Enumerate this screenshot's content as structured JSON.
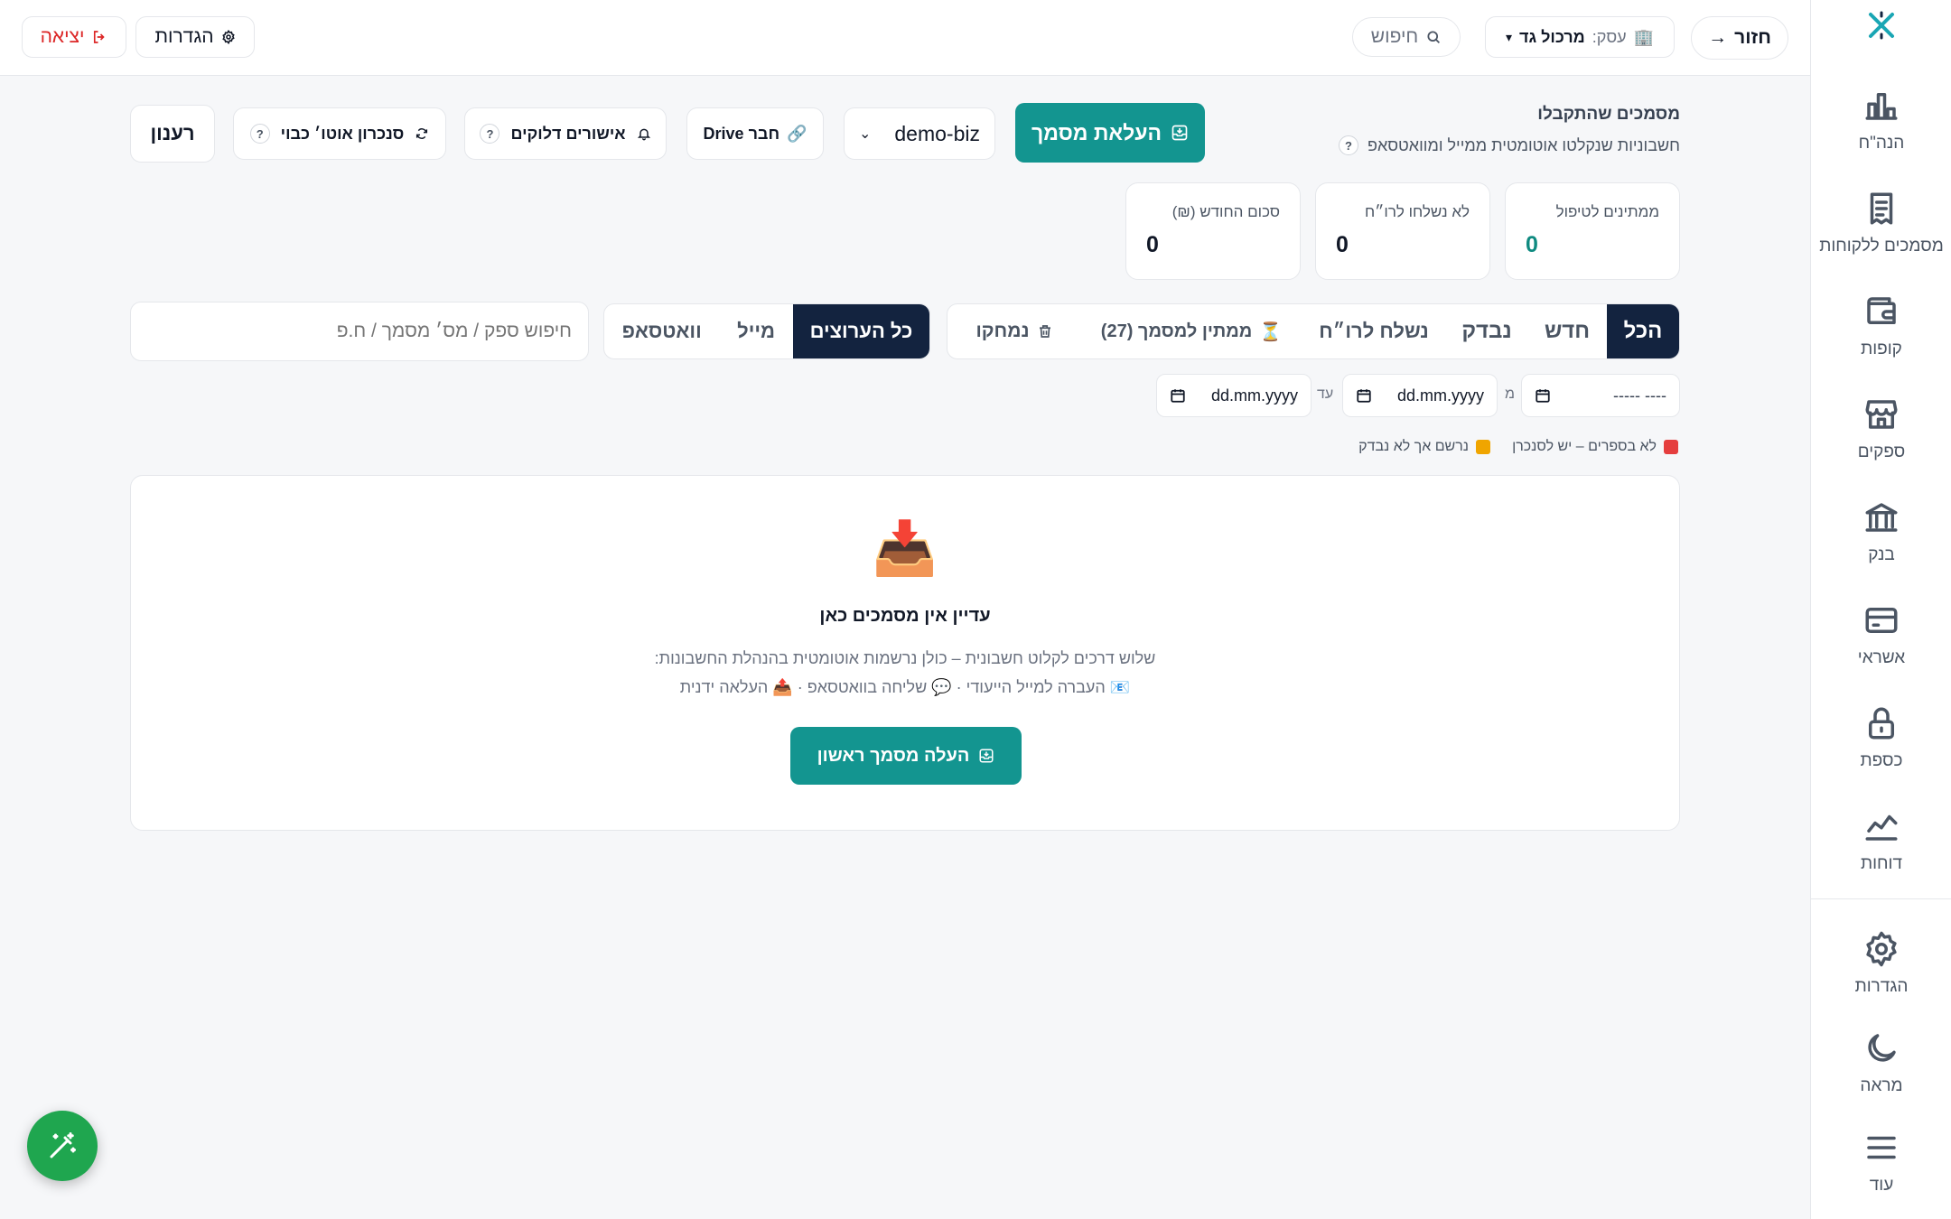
{
  "sidebar": {
    "items": [
      {
        "label": "הנה\"ח",
        "icon": "bar-chart-icon"
      },
      {
        "label": "מסמכים ללקוחות",
        "icon": "receipt-icon"
      },
      {
        "label": "קופות",
        "icon": "wallet-icon"
      },
      {
        "label": "ספקים",
        "icon": "store-icon"
      },
      {
        "label": "בנק",
        "icon": "bank-icon"
      },
      {
        "label": "אשראי",
        "icon": "credit-card-icon"
      },
      {
        "label": "כספת",
        "icon": "lock-icon"
      },
      {
        "label": "דוחות",
        "icon": "line-chart-icon"
      }
    ],
    "bottom": [
      {
        "label": "הגדרות",
        "icon": "gear-icon"
      },
      {
        "label": "מראה",
        "icon": "moon-icon"
      },
      {
        "label": "עוד",
        "icon": "menu-icon"
      }
    ]
  },
  "topbar": {
    "back_label": "חזור",
    "back_arrow": "→",
    "business_prefix": "עסק:",
    "business_name": "מרכול גד",
    "search_placeholder": "חיפוש",
    "settings_label": "הגדרות",
    "logout_label": "יציאה"
  },
  "header": {
    "title": "מסמכים שהתקבלו",
    "subtitle": "חשבוניות שנקלטו אוטומטית ממייל ומוואטסאפ",
    "help": "?"
  },
  "actions": {
    "upload_label": "העלאת מסמך",
    "business_select": "demo-biz",
    "drive_label": "חבר Drive",
    "urgent_label": "אישורים דלוקים",
    "autosync_label": "סנכרון אוטו׳ כבוי",
    "refresh_label": "רענון",
    "help": "?"
  },
  "stats": [
    {
      "label": "ממתינים לטיפול",
      "value": "0",
      "color": "#0f8a80"
    },
    {
      "label": "לא נשלחו לרו״ח",
      "value": "0",
      "color": "#111827"
    },
    {
      "label": "סכום החודש (₪)",
      "value": "0",
      "color": "#111827"
    }
  ],
  "status_tabs": [
    {
      "label": "הכל",
      "active": true
    },
    {
      "label": "חדש",
      "active": false
    },
    {
      "label": "נבדק",
      "active": false
    },
    {
      "label": "נשלח לרו״ח",
      "active": false
    },
    {
      "label": "ממתין למסמך (27)",
      "icon": "⏳",
      "active": false
    },
    {
      "label": "נמחקו",
      "icon": "trash-icon",
      "active": false
    }
  ],
  "channel_tabs": [
    {
      "label": "כל הערוצים",
      "active": true
    },
    {
      "label": "מייל",
      "active": false
    },
    {
      "label": "וואטסאפ",
      "active": false
    }
  ],
  "filter": {
    "search_placeholder": "חיפוש ספק / מס׳ מסמך / ח.פ",
    "month_value": "----- ----",
    "from_label": "מ",
    "from_value": "dd.mm.yyyy",
    "to_label": "עד",
    "to_value": "dd.mm.yyyy"
  },
  "legend": [
    {
      "label": "לא בספרים – יש לסנכרן",
      "color": "#e53e3e"
    },
    {
      "label": "נרשם אך לא נבדק",
      "color": "#f0a500"
    }
  ],
  "empty": {
    "icon": "📥",
    "title": "עדיין אין מסמכים כאן",
    "line1": "שלוש דרכים לקלוט חשבונית – כולן נרשמות אוטומטית בהנהלת החשבונות:",
    "line2": "📧 העברה למייל הייעודי · 💬 שליחה בוואטסאפ · 📤 העלאה ידנית",
    "cta_label": "העלה מסמך ראשון"
  },
  "colors": {
    "primary": "#139590",
    "navy": "#13233f",
    "danger": "#dc2626",
    "fab": "#1fa64f"
  }
}
